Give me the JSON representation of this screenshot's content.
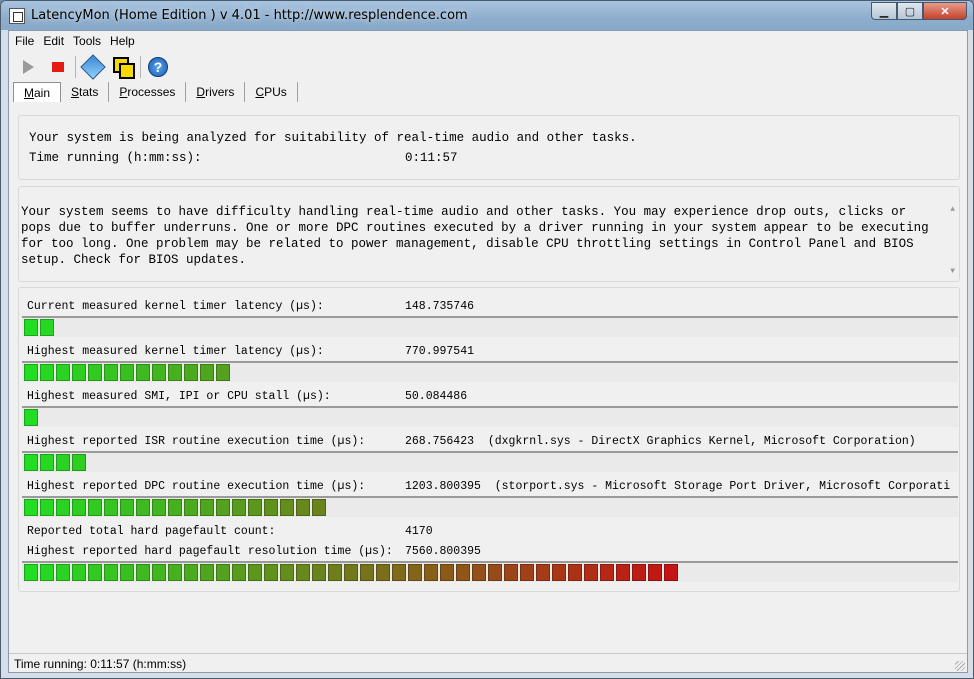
{
  "window": {
    "title": "LatencyMon  (Home Edition )  v 4.01 - http://www.resplendence.com"
  },
  "menu": [
    "File",
    "Edit",
    "Tools",
    "Help"
  ],
  "toolbar": {
    "buttons": [
      "play-icon",
      "stop-icon",
      "tools-icon",
      "cpu-icon",
      "help-icon"
    ],
    "help_glyph": "?"
  },
  "tabs": [
    "Main",
    "Stats",
    "Processes",
    "Drivers",
    "CPUs"
  ],
  "active_tab": "Main",
  "analysis": {
    "line1": "Your system is being analyzed for suitability of real-time audio and other tasks.",
    "time_label": "Time running (h:mm:ss):",
    "time_value": "0:11:57"
  },
  "conclusion": "Your system seems to have difficulty handling real-time audio and other tasks. You may experience drop outs, clicks or pops due to buffer underruns. One or more DPC routines executed by a driver running in your system appear to be executing for too long. One problem may be related to power management, disable CPU throttling settings in Control Panel and BIOS setup. Check for BIOS updates.",
  "metrics": [
    {
      "label": "Current measured kernel timer latency (µs):",
      "value": "148.735746",
      "detail": "",
      "segments": 2
    },
    {
      "label": "Highest measured kernel timer latency (µs):",
      "value": "770.997541",
      "detail": "",
      "segments": 13
    },
    {
      "label": "Highest measured SMI, IPI or CPU stall (µs):",
      "value": "50.084486",
      "detail": "",
      "segments": 1
    },
    {
      "label": "Highest reported ISR routine execution time (µs):",
      "value": "268.756423",
      "detail": "(dxgkrnl.sys - DirectX Graphics Kernel, Microsoft Corporation)",
      "segments": 4
    },
    {
      "label": "Highest reported DPC routine execution time (µs):",
      "value": "1203.800395",
      "detail": "(storport.sys - Microsoft Storage Port Driver, Microsoft Corporati",
      "segments": 19
    },
    {
      "label": "Reported total hard pagefault count:",
      "value": "4170",
      "detail": "",
      "segments": null
    },
    {
      "label": "Highest reported hard pagefault resolution time (µs):",
      "value": "7560.800395",
      "detail": "",
      "segments": 41
    }
  ],
  "bar_colors": [
    "#22dd22",
    "#c41414"
  ],
  "status": "Time running: 0:11:57  (h:mm:ss)"
}
